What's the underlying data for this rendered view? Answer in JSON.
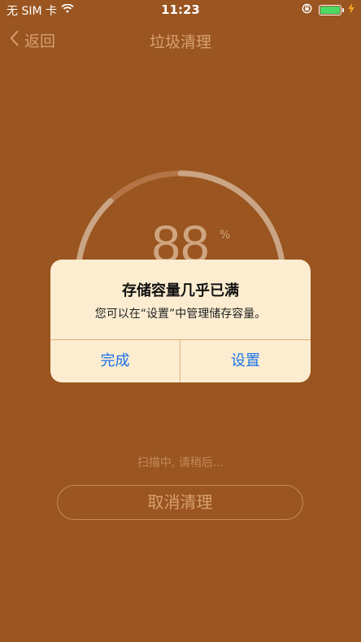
{
  "status_bar": {
    "carrier": "无 SIM 卡",
    "time": "11:23"
  },
  "nav": {
    "back_label": "返回",
    "title": "垃圾清理"
  },
  "progress": {
    "value": "88",
    "unit": "%",
    "fraction": 0.88
  },
  "scan_status": "扫描中, 请稍后...",
  "cancel_label": "取消清理",
  "alert": {
    "title": "存储容量几乎已满",
    "message": "您可以在“设置”中管理储存容量。",
    "done_label": "完成",
    "settings_label": "设置"
  },
  "colors": {
    "background": "#9a5520",
    "alert_bg": "#fcedd1",
    "accent_blue": "#1a73e8",
    "battery_green": "#4cd964"
  }
}
